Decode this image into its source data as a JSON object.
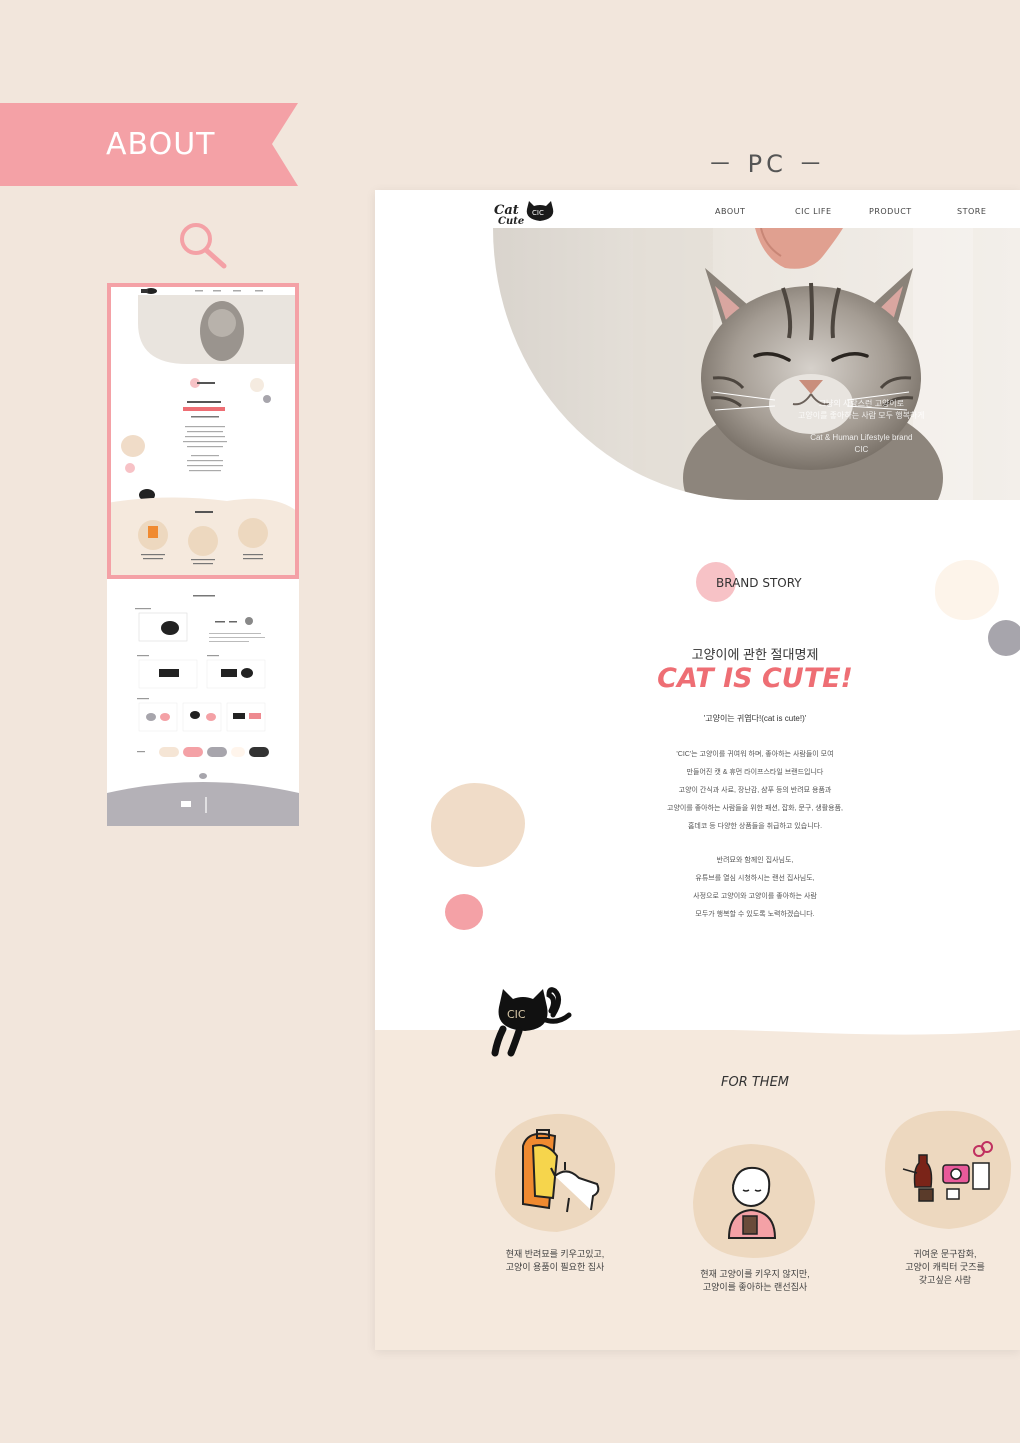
{
  "ribbon": {
    "label": "ABOUT"
  },
  "device_label": "－ PC －",
  "site": {
    "logo_alt": "Cat is Cute CIC",
    "nav": [
      "ABOUT",
      "CIC LIFE",
      "PRODUCT",
      "STORE"
    ],
    "hero_copy": [
      "그냥의 사랑스런 고양이로",
      "고양이를 좋아하는 사람 모두 행복하게",
      "Cat & Human Lifestyle brand",
      "CIC"
    ],
    "brand_story": "BRAND STORY",
    "slogan_sub": "고양이에 관한 절대명제",
    "slogan": "CAT IS CUTE!",
    "quote": "'고양이는 귀엽다!(cat is cute!)'",
    "paragraph1": [
      "'CIC'는 고양이를 귀여워 하며, 좋아하는 사람들이 모여",
      "만들어진 캣 & 휴먼 라이프스타일 브랜드입니다",
      "고양이 간식과 사료, 장난감, 샴푸 등의 반려묘 용품과",
      "고양이를 좋아하는 사람들을 위한 패션, 잡화, 문구, 생활용품,",
      "홈데코 등 다양한 상품들을 취급하고 있습니다."
    ],
    "paragraph2": [
      "반려묘와 함께인 집사님도,",
      "유튜브를 열심 시청하시는 랜선 집사님도,",
      "사정으로 고양이와 고양이를 좋아하는 사람",
      "모두가 행복할 수 있도록 노력하겠습니다."
    ],
    "for_them": "FOR THEM",
    "targets": [
      {
        "caption": [
          "현재 반려묘를 키우고있고,",
          "고양이 용품이 필요한 집사"
        ]
      },
      {
        "caption": [
          "현재 고양이를 키우지 않지만,",
          "고양이를 좋아하는 랜선집사"
        ]
      },
      {
        "caption": [
          "귀여운 문구잡화,",
          "고양이 캐릭터 굿즈를",
          "갖고싶은 사람"
        ]
      }
    ]
  },
  "colors": {
    "pink": "#f4a1a6",
    "coral": "#ee6e74",
    "beige": "#f5e9dd",
    "sand": "#edd8bf",
    "gray": "#a7a5ac"
  }
}
